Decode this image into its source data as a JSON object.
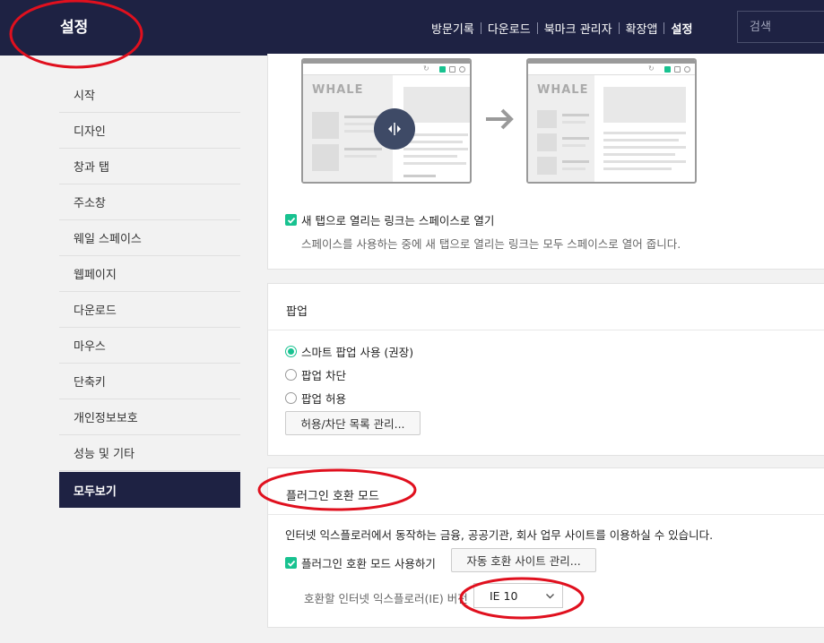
{
  "header": {
    "title": "설정",
    "nav": [
      {
        "label": "방문기록"
      },
      {
        "label": "다운로드"
      },
      {
        "label": "북마크 관리자"
      },
      {
        "label": "확장앱"
      },
      {
        "label": "설정",
        "active": true
      }
    ],
    "search_placeholder": "검색"
  },
  "sidebar": {
    "items": [
      {
        "label": "시작"
      },
      {
        "label": "디자인"
      },
      {
        "label": "창과 탭"
      },
      {
        "label": "주소창"
      },
      {
        "label": "웨일 스페이스"
      },
      {
        "label": "웹페이지"
      },
      {
        "label": "다운로드"
      },
      {
        "label": "마우스"
      },
      {
        "label": "단축키"
      },
      {
        "label": "개인정보보호"
      },
      {
        "label": "성능 및 기타"
      },
      {
        "label": "모두보기",
        "active": true
      }
    ]
  },
  "space_section": {
    "illustration_brand": "WHALE",
    "checkbox_label": "새 탭으로 열리는 링크는 스페이스로 열기",
    "checked": true,
    "description": "스페이스를 사용하는 중에 새 탭으로 열리는 링크는 모두 스페이스로 열어 줍니다."
  },
  "popup_section": {
    "title": "팝업",
    "options": [
      {
        "label": "스마트 팝업 사용 (권장)",
        "selected": true
      },
      {
        "label": "팝업 차단",
        "selected": false
      },
      {
        "label": "팝업 허용",
        "selected": false
      }
    ],
    "manage_button": "허용/차단 목록 관리..."
  },
  "plugin_section": {
    "title": "플러그인 호환 모드",
    "description": "인터넷 익스플로러에서 동작하는 금융, 공공기관, 회사 업무 사이트를 이용하실 수 있습니다.",
    "checkbox_label": "플러그인 호환 모드 사용하기",
    "checked": true,
    "auto_sites_button": "자동 호환 사이트 관리...",
    "ie_version_label": "호환할 인터넷 익스플로러(IE) 버전",
    "ie_version_value": "IE 10"
  },
  "colors": {
    "header_bg": "#1e2243",
    "accent": "#18c290",
    "annotation": "#e0101e"
  }
}
